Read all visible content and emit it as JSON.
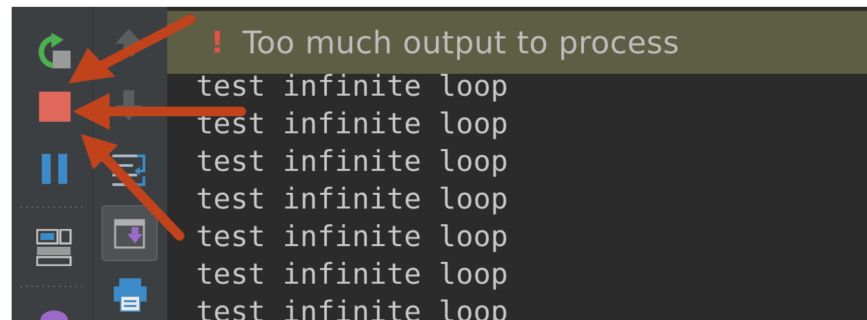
{
  "warning": {
    "icon": "!",
    "message": "Too much output to process"
  },
  "console": {
    "lines": [
      "test infinite loop",
      "test infinite loop",
      "test infinite loop",
      "test infinite loop",
      "test infinite loop",
      "test infinite loop",
      "test infinite loop"
    ]
  },
  "toolbar_left": [
    "rerun-icon",
    "stop-icon",
    "pause-icon",
    "layout-icon",
    "profiler-icon"
  ],
  "toolbar_right": [
    "up-arrow-icon",
    "down-arrow-icon",
    "soft-wrap-icon",
    "scroll-to-end-icon",
    "print-icon"
  ],
  "colors": {
    "warning_bar": "#5e5e44",
    "stop": "#e0685a",
    "annotation_arrow": "#c1431c",
    "pause": "#3d8ac9",
    "rerun": "#4caf50"
  }
}
